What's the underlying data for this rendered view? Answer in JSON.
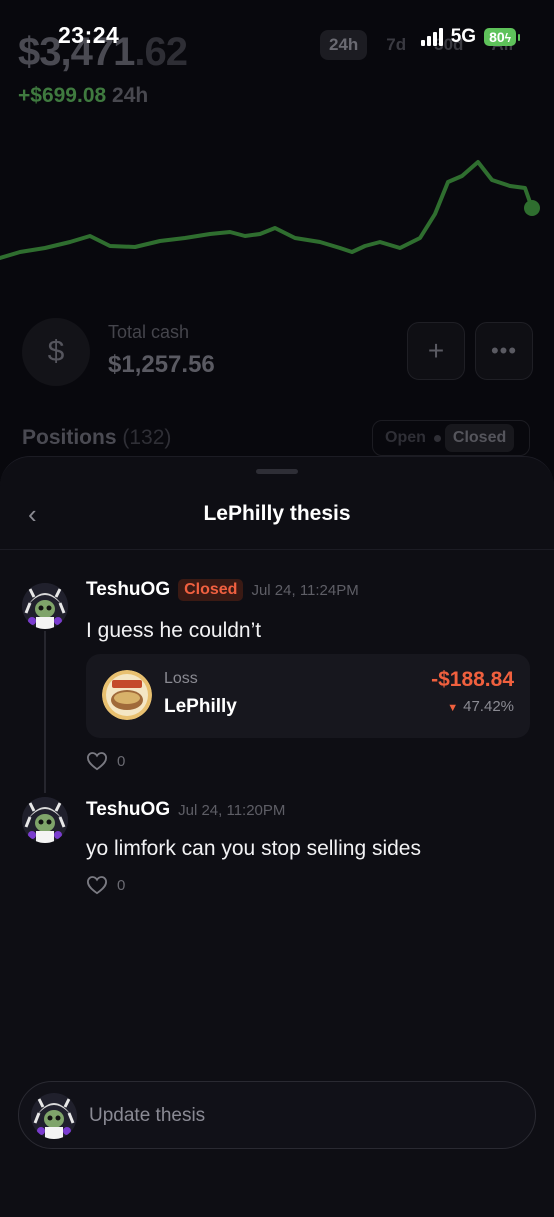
{
  "status_bar": {
    "time": "23:24",
    "network": "5G",
    "battery": "80"
  },
  "portfolio": {
    "balance_main": "$3,471",
    "balance_decimal": ".62",
    "change_amount": "+$699.08",
    "change_period": "24h",
    "periods": [
      "24h",
      "7d",
      "30d",
      "All"
    ],
    "active_period": "24h"
  },
  "cash": {
    "label": "Total cash",
    "value": "$1,257.56",
    "add_icon": "plus-icon",
    "more_icon": "more-icon"
  },
  "positions": {
    "label": "Positions",
    "count": "(132)",
    "toggle": [
      "Open",
      "Closed"
    ],
    "active_toggle": "Closed"
  },
  "sheet": {
    "title": "LePhilly thesis",
    "posts": [
      {
        "username": "TeshuOG",
        "badge": "Closed",
        "timestamp": "Jul 24, 11:24PM",
        "message": "I guess he couldn’t",
        "trade": {
          "type": "Loss",
          "name": "LePhilly",
          "amount": "-$188.84",
          "percent": "47.42%"
        },
        "likes": "0"
      },
      {
        "username": "TeshuOG",
        "timestamp": "Jul 24, 11:20PM",
        "message": "yo limfork can you stop selling sides",
        "likes": "0"
      }
    ],
    "compose_placeholder": "Update thesis"
  },
  "colors": {
    "accent_green": "#3a8a3a",
    "loss_red": "#f0603e",
    "battery_green": "#5ec25a"
  }
}
